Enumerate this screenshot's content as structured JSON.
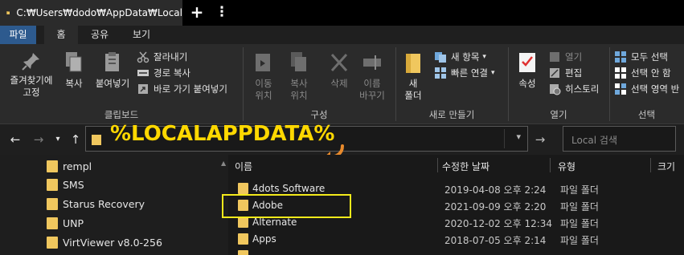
{
  "window": {
    "tab_title": "C:₩Users₩dodo₩AppData₩Local",
    "add_tab": "+",
    "more": "⋮"
  },
  "ribbon_tabs": [
    "파일",
    "홈",
    "공유",
    "보기"
  ],
  "ribbon": {
    "clipboard": {
      "pin": [
        "즐겨찾기에",
        "고정"
      ],
      "copy": "복사",
      "paste": "붙여넣기",
      "cut": "잘라내기",
      "copy_path": "경로 복사",
      "paste_shortcut": "바로 가기 붙여넣기",
      "label": "클립보드"
    },
    "organize": {
      "move_to": [
        "이동",
        "위치"
      ],
      "copy_to": [
        "복사",
        "위치"
      ],
      "delete": "삭제",
      "rename": [
        "이름",
        "바꾸기"
      ],
      "label": "구성"
    },
    "new": {
      "new_folder": [
        "새",
        "폴더"
      ],
      "new_item": "새 항목",
      "easy_access": "빠른 연결",
      "label": "새로 만들기"
    },
    "open": {
      "properties": "속성",
      "open": "열기",
      "edit": "편집",
      "history": "히스토리",
      "label": "열기"
    },
    "select": {
      "select_all": "모두 선택",
      "select_none": "선택 안 함",
      "invert": "선택 영역 반",
      "label": "선택"
    }
  },
  "address": {
    "path": "%LOCALAPPDATA%",
    "search_placeholder": "Local 검색"
  },
  "nav_items": [
    "rempl",
    "SMS",
    "Starus Recovery",
    "UNP",
    "VirtViewer v8.0-256"
  ],
  "columns": {
    "name": "이름",
    "date": "수정한 날짜",
    "type": "유형",
    "size": "크기"
  },
  "files": [
    {
      "name": "4dots Software",
      "date": "2019-04-08 오후 2:24",
      "type": "파일 폴더"
    },
    {
      "name": "Adobe",
      "date": "2021-09-09 오후 2:20",
      "type": "파일 폴더"
    },
    {
      "name": "Alternate",
      "date": "2020-12-02 오후 12:34",
      "type": "파일 폴더"
    },
    {
      "name": "Apps",
      "date": "2018-07-05 오후 2:14",
      "type": "파일 폴더"
    }
  ],
  "colors": {
    "accent": "#2d5a8e",
    "highlight": "#f4ea1b",
    "address_text": "#ffd800",
    "folder": "#f0c75e"
  }
}
